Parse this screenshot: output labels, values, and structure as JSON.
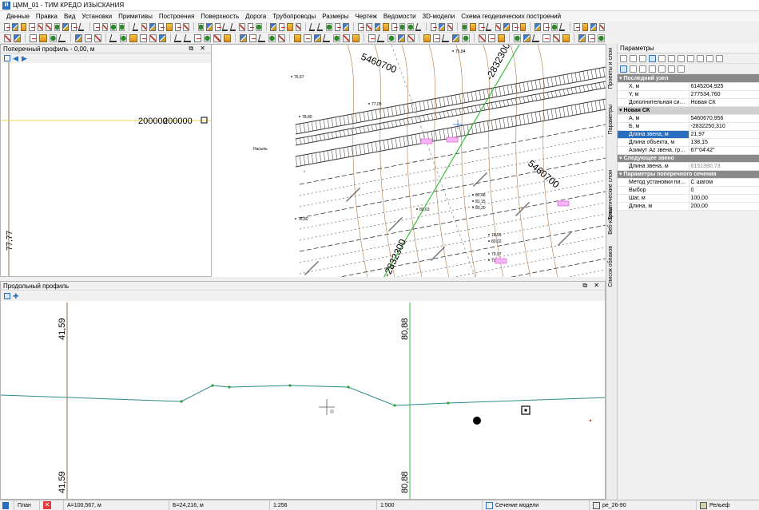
{
  "window": {
    "title": "ЦММ_01 - ТИМ КРЕДО ИЗЫСКАНИЯ"
  },
  "menu": [
    "Данные",
    "Правка",
    "Вид",
    "Установки",
    "Примитивы",
    "Построения",
    "Поверхность",
    "Дорога",
    "Трубопроводы",
    "Размеры",
    "Чертеж",
    "Ведомости",
    "3D-модели",
    "Схема геодезических построений"
  ],
  "cross_section": {
    "title": "Поперечный профиль - 0,00, м",
    "label_values": "200000",
    "label_left": "77,77"
  },
  "plan": {
    "grid_labels": [
      "5460700",
      "-2832300",
      "5460700",
      "-2832300"
    ],
    "point_labels": [
      "76,67",
      "75,84",
      "78,80",
      "77,05",
      "80,48",
      "81,15",
      "80,20",
      "80,63",
      "78,55",
      "80,02",
      "79,97",
      "79,01",
      "78,80"
    ],
    "place_label": "Насыпь"
  },
  "long_profile": {
    "title": "Продольный профиль",
    "marks": [
      {
        "value": "41,59"
      },
      {
        "value": "80,88"
      }
    ]
  },
  "params_panel": {
    "title": "Параметры",
    "vtabs": [
      "Проекты и слои",
      "Параметры",
      "Тематические слои",
      "Веб-карты",
      "Список облаков"
    ],
    "groups": [
      {
        "label": "Последний узел",
        "rows": [
          {
            "k": "X, м",
            "v": "6145204,925"
          },
          {
            "k": "Y, м",
            "v": "277534,760"
          },
          {
            "k": "Дополнительная система коор...",
            "v": "Новая СК"
          }
        ]
      },
      {
        "label": "Новая СК",
        "sub": true,
        "rows": [
          {
            "k": "А, м",
            "v": "5460670,956"
          },
          {
            "k": "Б, м",
            "v": "-2832250,310"
          }
        ]
      },
      {
        "label": "",
        "rows": [
          {
            "k": "Длина звена, м",
            "v": "21,97",
            "selected": true
          },
          {
            "k": "Длина объекта, м",
            "v": "138,15"
          },
          {
            "k": "Азимут Аz звена, град.",
            "v": "67°04'42\""
          }
        ]
      },
      {
        "label": "Следующее звено",
        "rows": [
          {
            "k": "Длина звена, м",
            "v": "6151390,73",
            "dim": true
          }
        ]
      },
      {
        "label": "Параметры поперечного сечения",
        "rows": [
          {
            "k": "Метод установки пикета",
            "v": "С шагом"
          },
          {
            "k": "Выбор",
            "v": "0"
          },
          {
            "k": "Шаг, м",
            "v": "100,00"
          },
          {
            "k": "Длина, м",
            "v": "200,00"
          }
        ]
      }
    ]
  },
  "status": {
    "tab": "План",
    "a": "А=100,567, м",
    "b": "Б=24,216, м",
    "scale1": "1:256",
    "scale2": "1:500",
    "section": "Сечение модели",
    "sheet": "ре_26-90",
    "relief": "Рельеф"
  },
  "colors": {
    "accent": "#2a6fbf",
    "grid_green": "#3cbf3c",
    "profile_line": "#2e8b8b",
    "highlight": "#e060e0"
  }
}
